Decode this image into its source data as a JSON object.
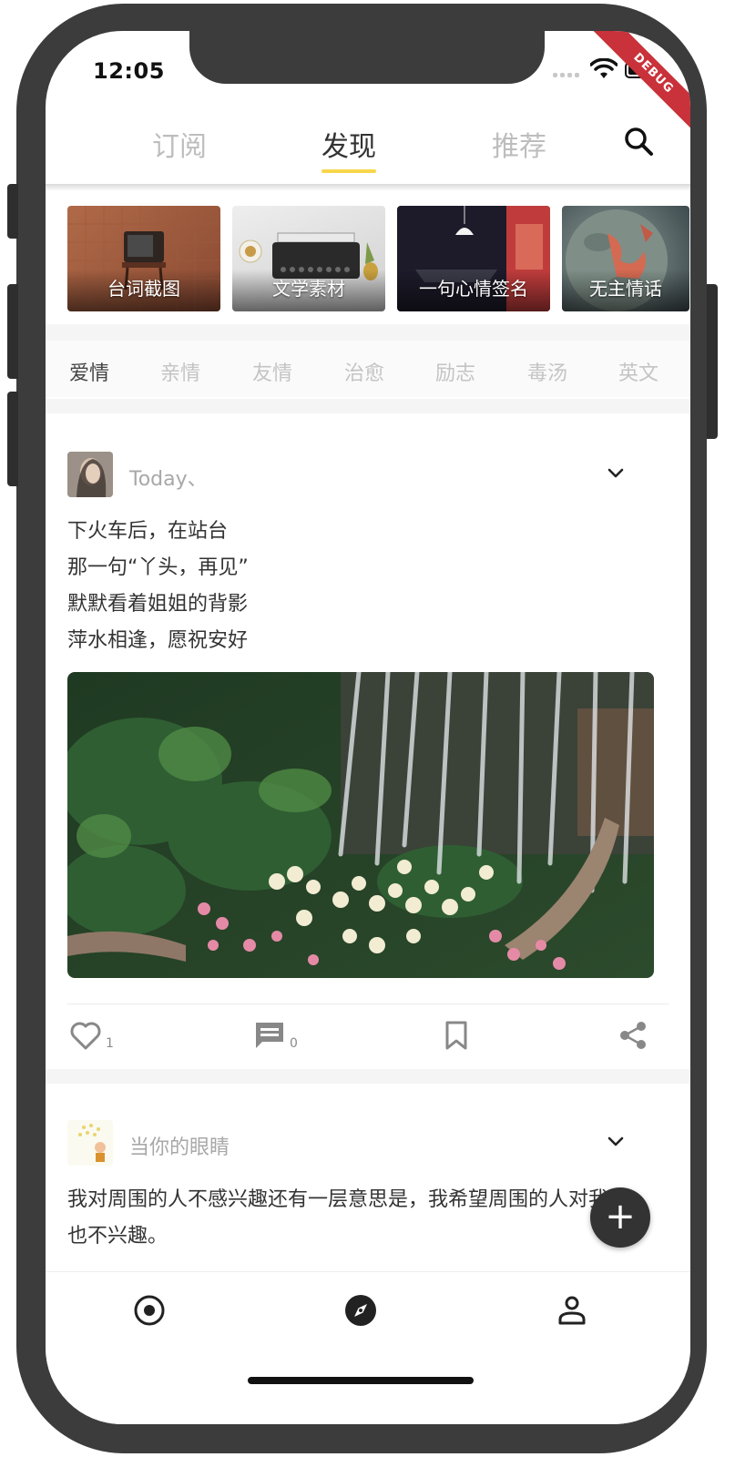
{
  "status_bar": {
    "time": "12:05",
    "debug_label": "DEBUG"
  },
  "top_tabs": [
    {
      "label": "订阅",
      "active": false
    },
    {
      "label": "发现",
      "active": true
    },
    {
      "label": "推荐",
      "active": false
    }
  ],
  "icons": {
    "search": "search-icon",
    "expand": "chevron-down-icon",
    "like": "heart-outline-icon",
    "comment": "comment-icon",
    "bookmark": "bookmark-icon",
    "share": "share-icon",
    "fab": "plus-icon",
    "nav_home": "radio-circle-icon",
    "nav_discover": "compass-icon",
    "nav_profile": "person-icon"
  },
  "category_cards": [
    {
      "label": "台词截图"
    },
    {
      "label": "文学素材"
    },
    {
      "label": "一句心情签名"
    },
    {
      "label": "无主情话"
    }
  ],
  "tags": [
    {
      "label": "爱情",
      "active": true
    },
    {
      "label": "亲情",
      "active": false
    },
    {
      "label": "友情",
      "active": false
    },
    {
      "label": "治愈",
      "active": false
    },
    {
      "label": "励志",
      "active": false
    },
    {
      "label": "毒汤",
      "active": false
    },
    {
      "label": "英文",
      "active": false
    }
  ],
  "posts": [
    {
      "username": "Today、",
      "lines": [
        "下火车后，在站台",
        "那一句“丫头，再见”",
        "默默看着姐姐的背影",
        "萍水相逢，愿祝安好"
      ],
      "like_count": "1",
      "comment_count": "0"
    },
    {
      "username": "当你的眼睛",
      "lines": [
        "我对周围的人不感兴趣还有一层意思是，我希望周围的人对我",
        "也不兴趣。"
      ]
    }
  ],
  "fab": {
    "symbol": "+"
  },
  "colors": {
    "accent": "#f8d64c",
    "dark": "#333333",
    "muted": "#bdbdbd",
    "debug": "#c9323a"
  }
}
